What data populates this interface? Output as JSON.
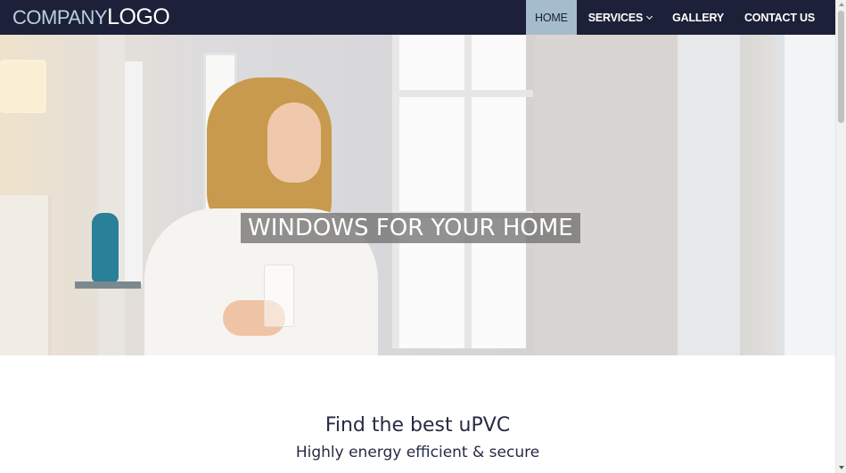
{
  "header": {
    "logo_company": "Company",
    "logo_logo": "Logo"
  },
  "nav": {
    "items": [
      {
        "label": "HOME",
        "active": true
      },
      {
        "label": "SERVICES",
        "has_dropdown": true
      },
      {
        "label": "GALLERY"
      },
      {
        "label": "CONTACT US"
      }
    ]
  },
  "hero": {
    "title": "WINDOWS FOR YOUR HOME"
  },
  "content": {
    "heading": "Find the best uPVC",
    "subheading": "Highly energy efficient & secure"
  },
  "colors": {
    "navbar_bg": "#1c2038",
    "active_nav_bg": "#a4bccb",
    "logo_accent": "#b9d0de",
    "text_dark": "#262b44"
  },
  "icons": {
    "dropdown": "chevron-down-icon"
  }
}
